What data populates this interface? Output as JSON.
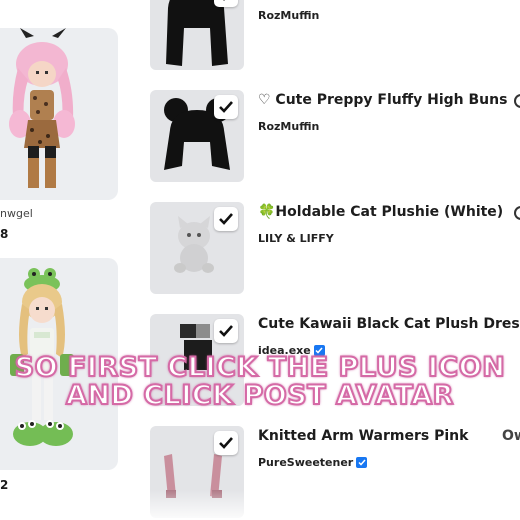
{
  "avatars": [
    {
      "name": "nwgel",
      "count": "8"
    },
    {
      "name": "",
      "count": "2"
    }
  ],
  "items": [
    {
      "title": "",
      "creator": "RozMuffin",
      "verified": false,
      "selected": true,
      "edge": "",
      "thumb": "black-long-hair"
    },
    {
      "title": "♡ Cute Preppy Fluffy High Buns",
      "creator": "RozMuffin",
      "verified": false,
      "selected": true,
      "edge": "icon",
      "thumb": "black-buns-hair"
    },
    {
      "title": "🍀Holdable Cat Plushie (White)",
      "creator": "LILY & LIFFY",
      "verified": false,
      "selected": true,
      "edge": "icon",
      "thumb": "white-cat-plushie"
    },
    {
      "title": "Cute Kawaii Black Cat Plush Dress",
      "creator": "idea.exe",
      "verified": true,
      "selected": true,
      "edge": "",
      "thumb": "black-cat-dress"
    },
    {
      "title": "Knitted Arm Warmers Pink",
      "creator": "PureSweetener",
      "verified": true,
      "selected": true,
      "edge": "Ow",
      "thumb": "pink-arm-warmers"
    }
  ],
  "caption": {
    "line1": "SO FIRST CLICK THE PLUS ICON",
    "line2": "AND CLICK POST AVATAR"
  },
  "colors": {
    "caption_outline": "#d56aa6",
    "verified_badge": "#1877f2",
    "thumb_bg": "#e3e4e7"
  }
}
